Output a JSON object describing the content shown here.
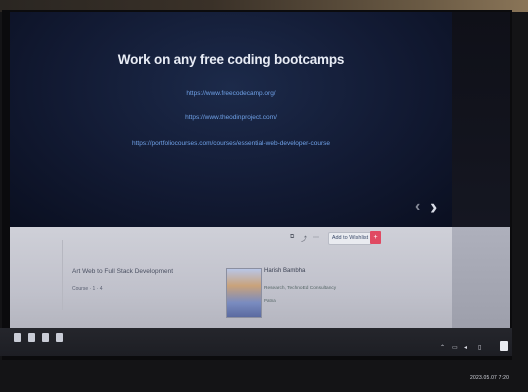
{
  "slide": {
    "title": "Work on any free coding bootcamps",
    "links": [
      "https://www.freecodecamp.org/",
      "https://www.theodinproject.com/",
      "https://portfoliocourses.com/courses/essential-web-developer-course"
    ]
  },
  "controls": {
    "follow_label": "Add to Wishlist",
    "red_label": "+"
  },
  "course": {
    "title": "Art Web to Full Stack Development",
    "meta": "Course · 1 · 4"
  },
  "author": {
    "name": "Harish Bambha",
    "role": "Research, TechnoEd Consultancy",
    "location": "Patna"
  },
  "taskbar": {
    "icon_names": [
      "start-icon",
      "search-icon",
      "task-view-icon",
      "explorer-icon"
    ],
    "labels": [
      "",
      "",
      "",
      ""
    ]
  },
  "tray": {
    "datetime": "2023.05.07 7:20"
  },
  "colors": {
    "slide_bg": "#121a33",
    "link": "#6fa0e6",
    "accent_red": "#e04a62"
  }
}
